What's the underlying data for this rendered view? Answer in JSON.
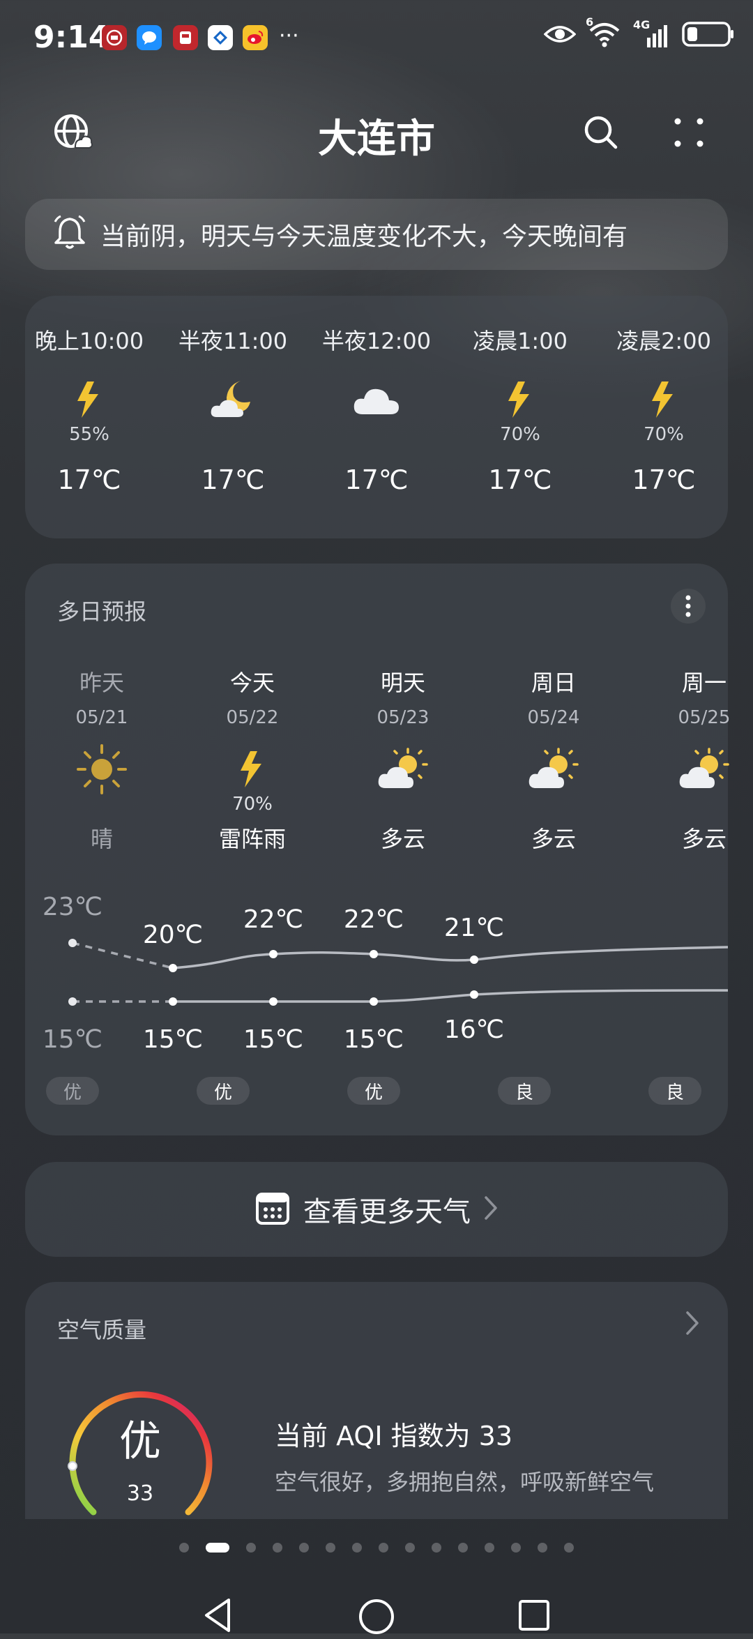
{
  "status_bar": {
    "time": "9:14",
    "notification_icons": [
      "bank-app-icon",
      "message-app-icon",
      "railway-app-icon",
      "bank-card-app-icon",
      "weibo-app-icon"
    ],
    "more": "···",
    "indicators": [
      "eye-icon",
      "wifi-icon",
      "4g-signal-icon",
      "battery-icon"
    ],
    "wifi_badge": "6",
    "network_label": "4G"
  },
  "header": {
    "city": "大连市"
  },
  "alert": {
    "text": "当前阴，明天与今天温度变化不大，今天晚间有"
  },
  "hourly": [
    {
      "time": "晚上10:00",
      "icon": "thunder-icon",
      "precip": "55%",
      "temp": "17℃"
    },
    {
      "time": "半夜11:00",
      "icon": "moon-cloud-icon",
      "precip": "",
      "temp": "17℃"
    },
    {
      "time": "半夜12:00",
      "icon": "cloud-icon",
      "precip": "",
      "temp": "17℃"
    },
    {
      "time": "凌晨1:00",
      "icon": "thunder-icon",
      "precip": "70%",
      "temp": "17℃"
    },
    {
      "time": "凌晨2:00",
      "icon": "thunder-icon",
      "precip": "70%",
      "temp": "17℃"
    }
  ],
  "daily": {
    "title": "多日预报",
    "days": [
      {
        "name": "昨天",
        "date": "05/21",
        "icon": "sun-icon",
        "precip": "",
        "condition": "晴",
        "high": "23℃",
        "low": "15℃",
        "aqi": "优"
      },
      {
        "name": "今天",
        "date": "05/22",
        "icon": "thunder-icon",
        "precip": "70%",
        "condition": "雷阵雨",
        "high": "20℃",
        "low": "15℃",
        "aqi": "优"
      },
      {
        "name": "明天",
        "date": "05/23",
        "icon": "partly-cloudy-icon",
        "precip": "",
        "condition": "多云",
        "high": "22℃",
        "low": "15℃",
        "aqi": "优"
      },
      {
        "name": "周日",
        "date": "05/24",
        "icon": "partly-cloudy-icon",
        "precip": "",
        "condition": "多云",
        "high": "22℃",
        "low": "15℃",
        "aqi": "良"
      },
      {
        "name": "周一",
        "date": "05/25",
        "icon": "partly-cloudy-icon",
        "precip": "",
        "condition": "多云",
        "high": "21℃",
        "low": "16℃",
        "aqi": "良"
      }
    ]
  },
  "more_weather": {
    "label": "查看更多天气"
  },
  "air_quality": {
    "title": "空气质量",
    "grade": "优",
    "value": "33",
    "headline": "当前 AQI 指数为 33",
    "description": "空气很好，多拥抱自然，呼吸新鲜空气"
  },
  "pager": {
    "count": 15,
    "active_index": 1
  },
  "colors": {
    "thunder": "#f3c432",
    "sun": "#c9a23a",
    "moon": "#f4c84a",
    "cloud": "#eef0f3"
  }
}
